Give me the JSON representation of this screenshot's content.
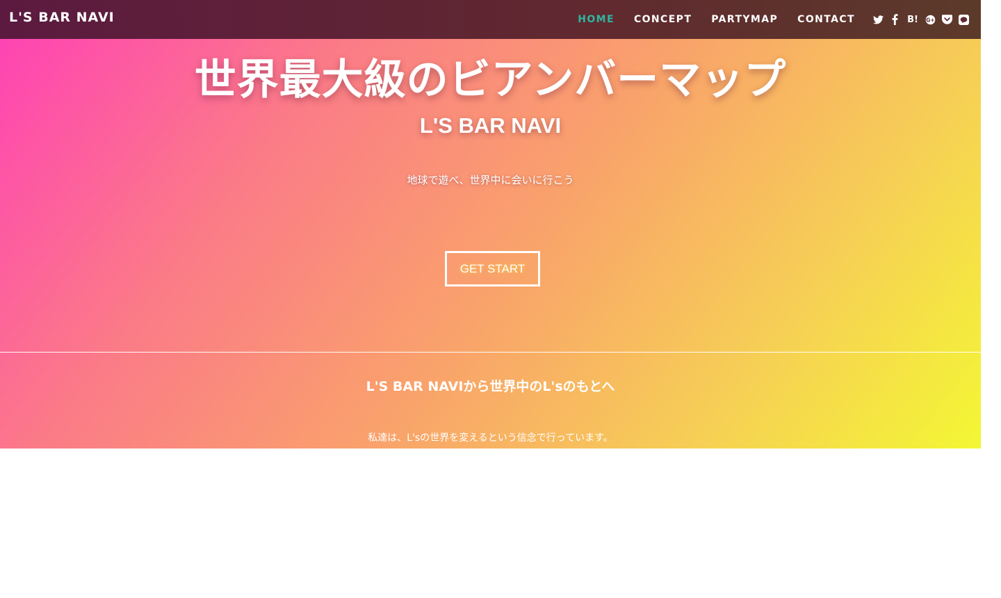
{
  "navbar": {
    "brand": "L'S BAR NAVI",
    "links": [
      {
        "label": "HOME",
        "active": true
      },
      {
        "label": "CONCEPT",
        "active": false
      },
      {
        "label": "PARTYMAP",
        "active": false
      },
      {
        "label": "CONTACT",
        "active": false
      }
    ],
    "social_icons": [
      "twitter-icon",
      "facebook-icon",
      "hatena-bookmark-icon",
      "google-plus-icon",
      "pocket-icon",
      "line-icon"
    ],
    "hatena_label": "B!",
    "active_color": "#2fb5a0"
  },
  "hero": {
    "title": "世界最大級のビアンバーマップ",
    "subtitle": "L'S BAR NAVI",
    "tagline": "地球で遊べ、世界中に会いに行こう",
    "cta_label": "GET START"
  },
  "section": {
    "title": "L'S BAR NAVIから世界中のL'sのもとへ",
    "text": "私達は、L'sの世界を変えるという信念で行っています。"
  },
  "colors": {
    "gradient_start": "#ff3fb7",
    "gradient_end": "#f4f734",
    "navbar_bg": "#5c1a40"
  }
}
